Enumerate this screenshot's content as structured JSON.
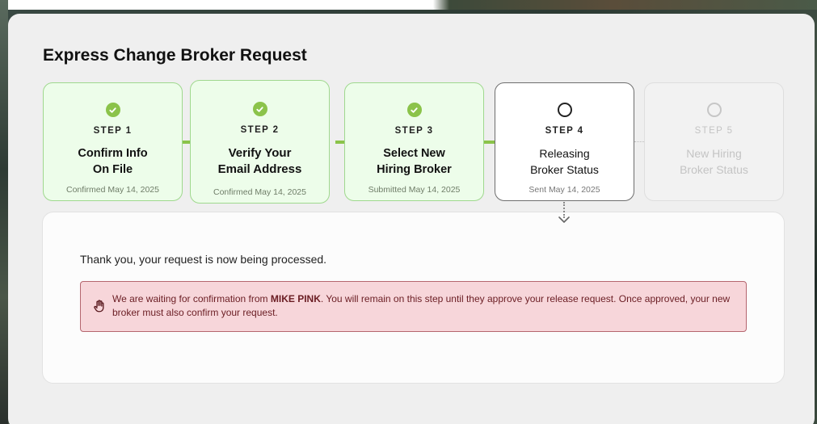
{
  "page": {
    "title": "Express Change Broker Request"
  },
  "steps": [
    {
      "number": "STEP 1",
      "name_line1": "Confirm Info",
      "name_line2": "On File",
      "date": "Confirmed May 14, 2025",
      "status": "complete",
      "icon": "check-circle-icon"
    },
    {
      "number": "STEP 2",
      "name_line1": "Verify Your",
      "name_line2": "Email Address",
      "date": "Confirmed May 14, 2025",
      "status": "complete",
      "icon": "check-circle-icon"
    },
    {
      "number": "STEP 3",
      "name_line1": "Select New",
      "name_line2": "Hiring Broker",
      "date": "Submitted May 14, 2025",
      "status": "complete",
      "icon": "check-circle-icon"
    },
    {
      "number": "STEP 4",
      "name_line1": "Releasing",
      "name_line2": "Broker Status",
      "date": "Sent May 14, 2025",
      "status": "current",
      "icon": "empty-circle-icon"
    },
    {
      "number": "STEP 5",
      "name_line1": "New Hiring",
      "name_line2": "Broker Status",
      "date": "",
      "status": "pending",
      "icon": "empty-circle-icon"
    }
  ],
  "content": {
    "thanks": "Thank you, your request is now being processed.",
    "alert": {
      "icon": "raised-hand-icon",
      "prefix": "We are waiting for confirmation from ",
      "name": "MIKE PINK",
      "suffix": ". You will remain on this step until they approve your release request. Once approved, your new broker must also confirm your request."
    }
  },
  "colors": {
    "complete_accent": "#8bc34a",
    "alert_background": "#f7d6da",
    "alert_text": "#6a1d23"
  }
}
